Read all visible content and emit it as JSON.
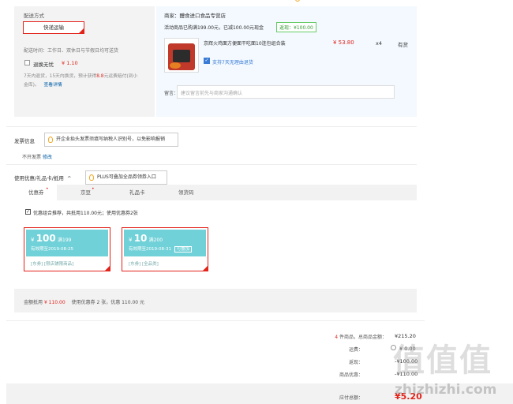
{
  "shipping": {
    "section_title": "配送方式",
    "method_button": "快递运输",
    "time_note": "配送时间：工作日、双休日与节假日均可送货",
    "return_option": "退换无忧",
    "return_price": "¥ 1.10",
    "return_desc_1": "7天内退货，15天内换货，预计获得",
    "return_desc_highlight": "8.8",
    "return_desc_2": "元运费赔付(到小",
    "return_desc_3": "金库)。",
    "return_detail_link": "查看详情"
  },
  "store": {
    "seller_label": "商家：",
    "seller_name": "醴食进口食品专营店",
    "promo_text": "活动商品已购满199.00元，已减100.00元现金",
    "promo_badge": "返现：¥100.00",
    "product_name": "京辉火鸡面方便面干吃面10连包组合装",
    "product_price": "¥ 53.80",
    "product_qty": "x4",
    "product_stock": "有货",
    "support_text": "支持7天无理由退货",
    "remark_label": "留言：",
    "remark_placeholder": "建议留言前先与商家沟通确认"
  },
  "invoice": {
    "title": "发票信息",
    "tip": "开企业抬头发票须填写纳税人识别号，以免影响报销",
    "status": "不开发票",
    "edit_link": "修改"
  },
  "discount": {
    "title": "使用优惠/礼品卡/抵用",
    "plus_tip": "PLUS可叠加全品券领券入口",
    "tabs": [
      "优惠券",
      "京豆",
      "礼品卡",
      "领货码"
    ],
    "combo_text": "优惠组合推荐，共抵用110.00元；使用优惠券2张",
    "coupons": [
      {
        "amount": "100",
        "cond": "满199",
        "valid": "有效期至2019-08-25",
        "tags": "[东券]  [限店铺限商品]",
        "extra": ""
      },
      {
        "amount": "10",
        "cond": "满200",
        "valid": "有效期至2019-08-31",
        "tags": "[东券]  [全品类]",
        "extra": "可叠加"
      }
    ],
    "summary_label": "金额抵用",
    "summary_amount": "¥ 110.00",
    "summary_detail": "使用优惠券 2 张，优惠 110.00 元"
  },
  "totals": {
    "items_count": "4",
    "items_label": "件商品，总商品金额：",
    "items_value": "¥215.20",
    "freight_label": "运费：",
    "freight_value": "¥ 0.00",
    "cashback_label": "返现：",
    "cashback_value": "-¥100.00",
    "discount_label": "商品优惠：",
    "discount_value": "-¥110.00",
    "payable_label": "应付总额：",
    "payable_value": "¥5.20"
  },
  "watermark": {
    "logo": "值",
    "site": "zhizhizhi.com"
  },
  "icon_names": [
    "info-icon",
    "support-icon",
    "bulb-icon",
    "chevron-up-icon",
    "checkbox-icon"
  ]
}
